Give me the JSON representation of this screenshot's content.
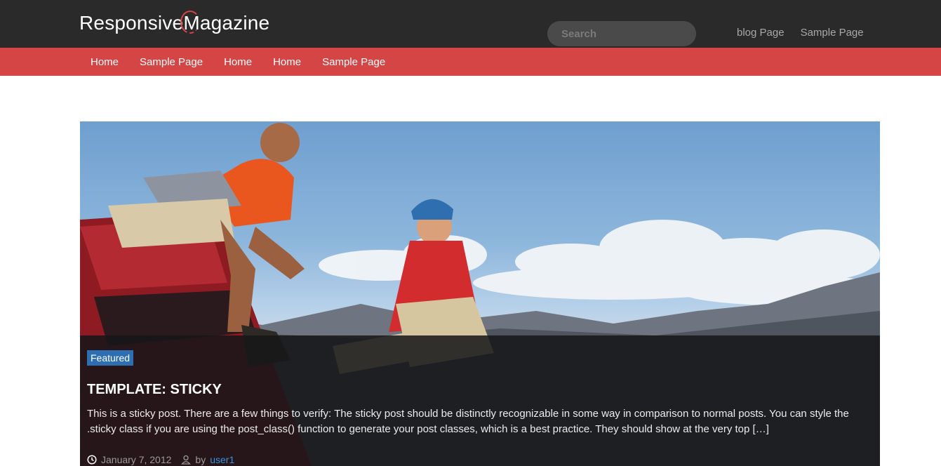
{
  "header": {
    "logo": {
      "part1": "Responsive",
      "m": "M",
      "part2": "agazine"
    },
    "search": {
      "placeholder": "Search"
    },
    "top_links": [
      "blog Page",
      "Sample Page"
    ]
  },
  "nav": {
    "items": [
      "Home",
      "Sample Page",
      "Home",
      "Home",
      "Sample Page"
    ]
  },
  "featured_post": {
    "badge": "Featured",
    "title": "TEMPLATE: STICKY",
    "excerpt": "This is a sticky post. There are a few things to verify: The sticky post should be distinctly recognizable in some way in comparison to normal posts. You can style the .sticky class if you are using the post_class() function to generate your post classes, which is a best practice. They should show at the very top […]",
    "date": "January 7, 2012",
    "by_label": "by",
    "author": "user1"
  },
  "icons": {
    "clock": "clock-icon",
    "user": "user-icon"
  },
  "colors": {
    "header_bg": "#2a2a2a",
    "nav_bg": "#d64545",
    "badge_bg": "#2d6fb0",
    "link": "#3a8fe0"
  }
}
